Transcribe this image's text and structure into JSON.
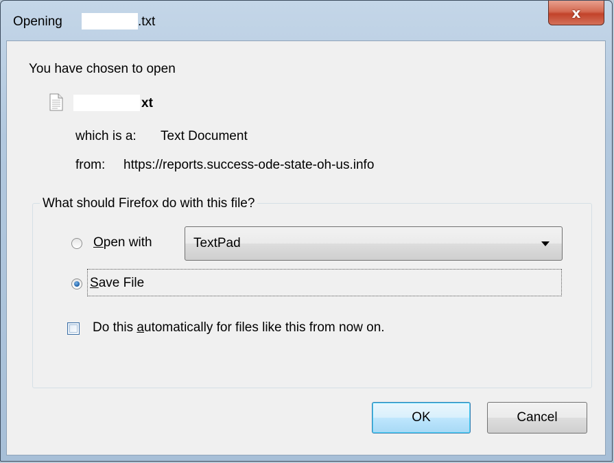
{
  "window": {
    "title_prefix": "Opening",
    "title_suffix": ".txt",
    "close_glyph": "x"
  },
  "intro": "You have chosen to open",
  "file": {
    "name_suffix": "xt",
    "icon": "text-file-icon",
    "type_label": "which is a:",
    "type_value": "Text Document",
    "from_label": "from:",
    "from_value": "https://reports.success-ode-state-oh-us.info"
  },
  "action_group": {
    "legend": "What should Firefox do with this file?",
    "open_with": {
      "label_mnemonic": "O",
      "label_rest": "pen with",
      "checked": false,
      "app_selected": "TextPad"
    },
    "save_file": {
      "label_mnemonic": "S",
      "label_rest": "ave File",
      "checked": true
    },
    "auto_checkbox": {
      "label_pre": "Do this ",
      "label_mnemonic": "a",
      "label_rest": "utomatically for files like this from now on.",
      "checked": false
    }
  },
  "buttons": {
    "ok": "OK",
    "cancel": "Cancel"
  },
  "colors": {
    "dialog_bg": "#f0f0f0",
    "title_bar": "#b2c8de",
    "close_button": "#c2432a",
    "default_button_border": "#3c7fb1"
  }
}
